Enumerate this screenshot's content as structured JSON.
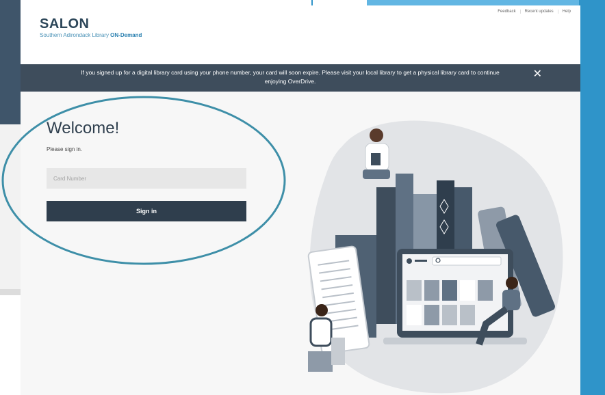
{
  "header": {
    "title": "SALON",
    "subtitle_prefix": "Southern Adirondack Library ",
    "subtitle_accent": "ON-Demand",
    "links": [
      "Feedback",
      "Recent updates",
      "Help"
    ]
  },
  "banner": {
    "message": "If you signed up for a digital library card using your phone number, your card will soon expire. Please visit your local library to get a physical library card to continue enjoying OverDrive.",
    "close_glyph": "✕"
  },
  "login": {
    "heading": "Welcome!",
    "prompt": "Please sign in.",
    "card_placeholder": "Card Number",
    "card_value": "",
    "button_label": "Sign in"
  },
  "colors": {
    "brand": "#2c4659",
    "accent": "#4c93b7",
    "banner_bg": "#3e4d5c",
    "button_bg": "#2f3e4d",
    "highlight_ellipse": "#3e8fa8"
  },
  "icons": [
    "close-icon",
    "search-icon"
  ]
}
